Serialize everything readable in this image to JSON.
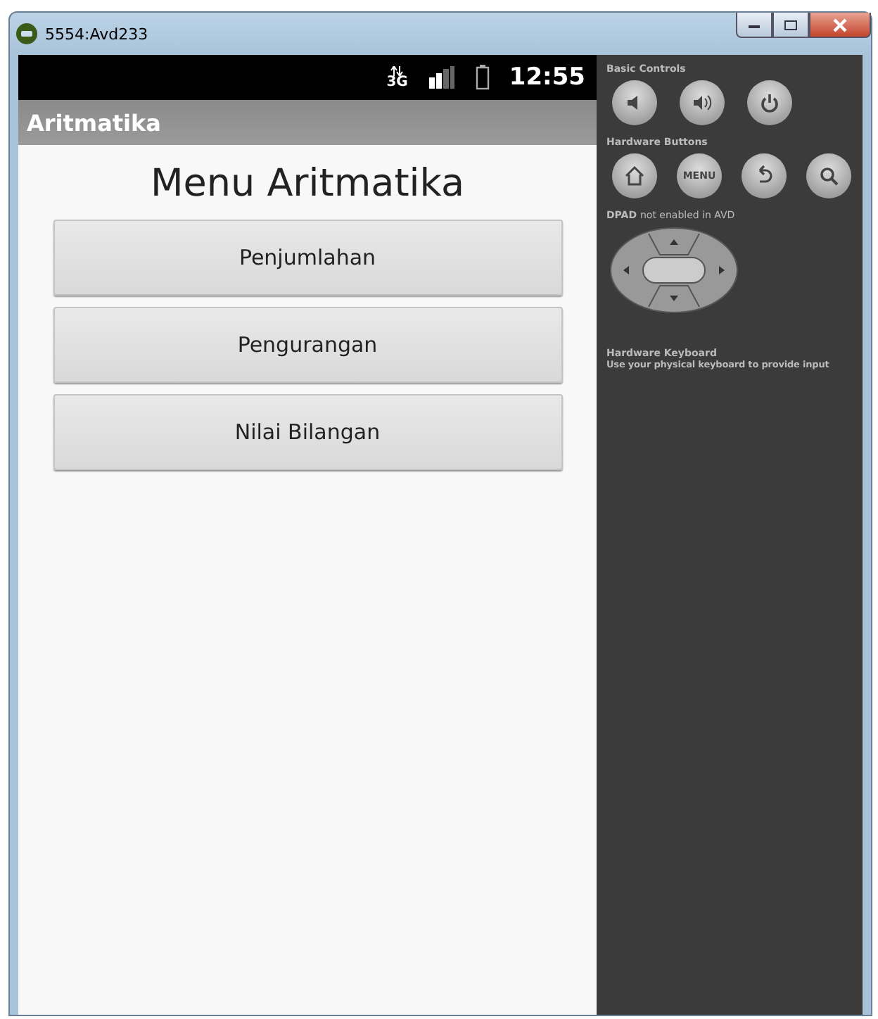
{
  "window": {
    "title": "5554:Avd233"
  },
  "status_bar": {
    "network": "3G",
    "time": "12:55"
  },
  "action_bar": {
    "title": "Aritmatika"
  },
  "heading": "Menu Aritmatika",
  "buttons": [
    "Penjumlahan",
    "Pengurangan",
    "Nilai Bilangan"
  ],
  "controls": {
    "basic_title": "Basic Controls",
    "hardware_title": "Hardware Buttons",
    "menu_label": "MENU",
    "dpad_title": "DPAD",
    "dpad_note": "not enabled in AVD",
    "keyboard_title": "Hardware Keyboard",
    "keyboard_note": "Use your physical keyboard to provide input"
  }
}
